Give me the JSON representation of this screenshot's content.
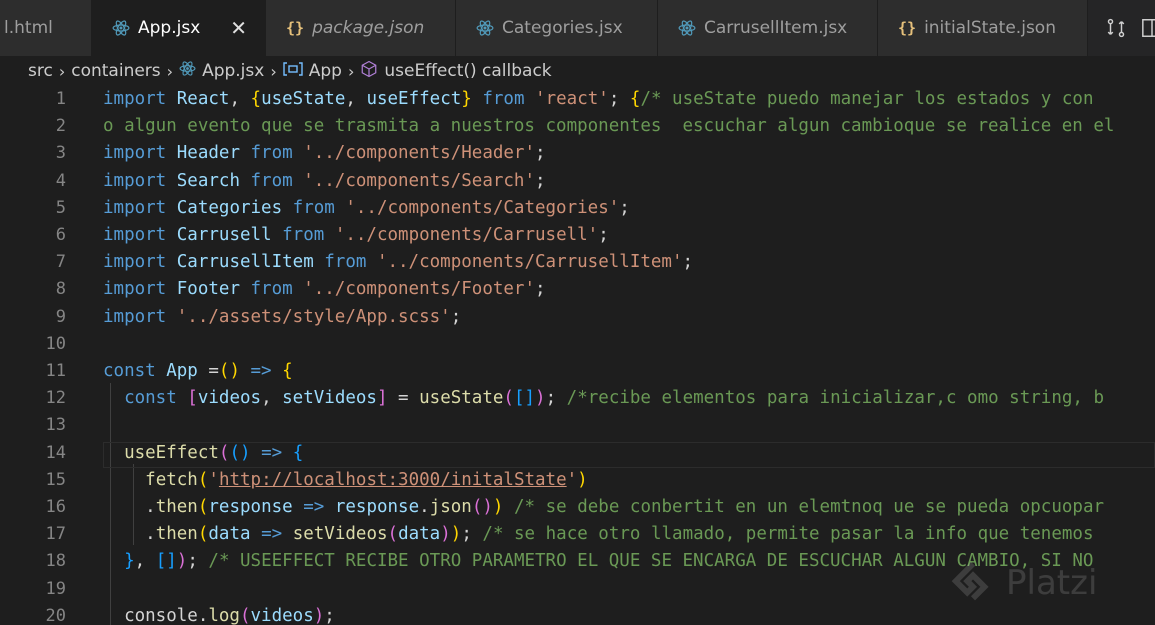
{
  "tabs": [
    {
      "label": "l.html",
      "icon": "none",
      "italic": false,
      "active": false
    },
    {
      "label": "App.jsx",
      "icon": "react-icon",
      "italic": false,
      "active": true
    },
    {
      "label": "package.json",
      "icon": "json-icon",
      "italic": true,
      "active": false
    },
    {
      "label": "Categories.jsx",
      "icon": "react-icon",
      "italic": false,
      "active": false
    },
    {
      "label": "CarrusellItem.jsx",
      "icon": "react-icon",
      "italic": false,
      "active": false
    },
    {
      "label": "initialState.json",
      "icon": "json-icon",
      "italic": false,
      "active": false
    }
  ],
  "json_icon_glyph": "{}",
  "close_glyph": "✕",
  "breadcrumb": {
    "src": "src",
    "containers": "containers",
    "file": "App.jsx",
    "symbol": "App",
    "callback": "useEffect() callback"
  },
  "colors": {
    "keyword": "#569cd6",
    "variable": "#9cdcfe",
    "string": "#ce9178",
    "comment": "#6a9955",
    "function": "#dcdcaa",
    "react_icon": "#519aba"
  },
  "lines": [
    {
      "n": "1",
      "t": [
        [
          "k",
          "import "
        ],
        [
          "v",
          "React"
        ],
        [
          "ty",
          ", "
        ],
        [
          "b1",
          "{"
        ],
        [
          "v",
          "useState"
        ],
        [
          "ty",
          ", "
        ],
        [
          "v",
          "useEffect"
        ],
        [
          "b1",
          "}"
        ],
        [
          "k",
          " from "
        ],
        [
          "s",
          "'react'"
        ],
        [
          "ty",
          "; "
        ],
        [
          "b1",
          "{"
        ],
        [
          "c",
          "/* useState puedo manejar los estados y con"
        ]
      ]
    },
    {
      "n": "2",
      "t": [
        [
          "c",
          "o algun evento que se trasmita a nuestros componentes  escuchar algun cambioque se realice en el"
        ]
      ]
    },
    {
      "n": "3",
      "t": [
        [
          "k",
          "import "
        ],
        [
          "v",
          "Header"
        ],
        [
          "k",
          " from "
        ],
        [
          "s",
          "'../components/Header'"
        ],
        [
          "ty",
          ";"
        ]
      ]
    },
    {
      "n": "4",
      "t": [
        [
          "k",
          "import "
        ],
        [
          "v",
          "Search"
        ],
        [
          "k",
          " from "
        ],
        [
          "s",
          "'../components/Search'"
        ],
        [
          "ty",
          ";"
        ]
      ]
    },
    {
      "n": "5",
      "t": [
        [
          "k",
          "import "
        ],
        [
          "v",
          "Categories"
        ],
        [
          "k",
          " from "
        ],
        [
          "s",
          "'../components/Categories'"
        ],
        [
          "ty",
          ";"
        ]
      ]
    },
    {
      "n": "6",
      "t": [
        [
          "k",
          "import "
        ],
        [
          "v",
          "Carrusell"
        ],
        [
          "k",
          " from "
        ],
        [
          "s",
          "'../components/Carrusell'"
        ],
        [
          "ty",
          ";"
        ]
      ]
    },
    {
      "n": "7",
      "t": [
        [
          "k",
          "import "
        ],
        [
          "v",
          "CarrusellItem"
        ],
        [
          "k",
          " from "
        ],
        [
          "s",
          "'../components/CarrusellItem'"
        ],
        [
          "ty",
          ";"
        ]
      ]
    },
    {
      "n": "8",
      "t": [
        [
          "k",
          "import "
        ],
        [
          "v",
          "Footer"
        ],
        [
          "k",
          " from "
        ],
        [
          "s",
          "'../components/Footer'"
        ],
        [
          "ty",
          ";"
        ]
      ]
    },
    {
      "n": "9",
      "t": [
        [
          "k",
          "import "
        ],
        [
          "s",
          "'../assets/style/App.scss'"
        ],
        [
          "ty",
          ";"
        ]
      ]
    },
    {
      "n": "10",
      "t": []
    },
    {
      "n": "11",
      "t": [
        [
          "k",
          "const "
        ],
        [
          "v",
          "App"
        ],
        [
          "ty",
          " ="
        ],
        [
          "b1",
          "()"
        ],
        [
          "k",
          " => "
        ],
        [
          "b1",
          "{"
        ]
      ]
    },
    {
      "n": "12",
      "t": [
        [
          "ty",
          "  "
        ],
        [
          "k",
          "const "
        ],
        [
          "b2",
          "["
        ],
        [
          "v",
          "videos"
        ],
        [
          "ty",
          ", "
        ],
        [
          "v",
          "setVideos"
        ],
        [
          "b2",
          "]"
        ],
        [
          "ty",
          " = "
        ],
        [
          "f",
          "useState"
        ],
        [
          "b2",
          "("
        ],
        [
          "b3",
          "[]"
        ],
        [
          "b2",
          ")"
        ],
        [
          "ty",
          "; "
        ],
        [
          "c",
          "/*recibe elementos para inicializar,c omo string, b"
        ]
      ]
    },
    {
      "n": "13",
      "t": []
    },
    {
      "n": "14",
      "t": [
        [
          "ty",
          "  "
        ],
        [
          "f",
          "useEffect"
        ],
        [
          "b2",
          "("
        ],
        [
          "b3",
          "()"
        ],
        [
          "k",
          " => "
        ],
        [
          "b3",
          "{"
        ]
      ]
    },
    {
      "n": "15",
      "t": [
        [
          "ty",
          "    "
        ],
        [
          "f",
          "fetch"
        ],
        [
          "b1",
          "("
        ],
        [
          "s",
          "'"
        ],
        [
          "su",
          "http://localhost:3000/initalState"
        ],
        [
          "s",
          "'"
        ],
        [
          "b1",
          ")"
        ]
      ]
    },
    {
      "n": "16",
      "t": [
        [
          "ty",
          "    ."
        ],
        [
          "f",
          "then"
        ],
        [
          "b1",
          "("
        ],
        [
          "v",
          "response"
        ],
        [
          "k",
          " => "
        ],
        [
          "v",
          "response"
        ],
        [
          "ty",
          "."
        ],
        [
          "f",
          "json"
        ],
        [
          "b2",
          "()"
        ],
        [
          "b1",
          ")"
        ],
        [
          "ty",
          " "
        ],
        [
          "c",
          "/* se debe conbertit en un elemtnoq ue se pueda opcuopar"
        ]
      ]
    },
    {
      "n": "17",
      "t": [
        [
          "ty",
          "    ."
        ],
        [
          "f",
          "then"
        ],
        [
          "b1",
          "("
        ],
        [
          "v",
          "data"
        ],
        [
          "k",
          " => "
        ],
        [
          "f",
          "setVideos"
        ],
        [
          "b2",
          "("
        ],
        [
          "v",
          "data"
        ],
        [
          "b2",
          ")"
        ],
        [
          "b1",
          ")"
        ],
        [
          "ty",
          "; "
        ],
        [
          "c",
          "/* se hace otro llamado, permite pasar la info que tenemos"
        ]
      ]
    },
    {
      "n": "18",
      "t": [
        [
          "ty",
          "  "
        ],
        [
          "b3",
          "}"
        ],
        [
          "ty",
          ", "
        ],
        [
          "b3",
          "[]"
        ],
        [
          "b2",
          ")"
        ],
        [
          "ty",
          "; "
        ],
        [
          "c",
          "/* USEEFFECT RECIBE OTRO PARAMETRO EL QUE SE ENCARGA DE ESCUCHAR ALGUN CAMBIO, SI NO"
        ]
      ]
    },
    {
      "n": "19",
      "t": []
    },
    {
      "n": "20",
      "t": [
        [
          "ty",
          "  console."
        ],
        [
          "f",
          "log"
        ],
        [
          "b2",
          "("
        ],
        [
          "v",
          "videos"
        ],
        [
          "b2",
          ")"
        ],
        [
          "ty",
          ";"
        ]
      ]
    }
  ],
  "watermark": "Platzi"
}
